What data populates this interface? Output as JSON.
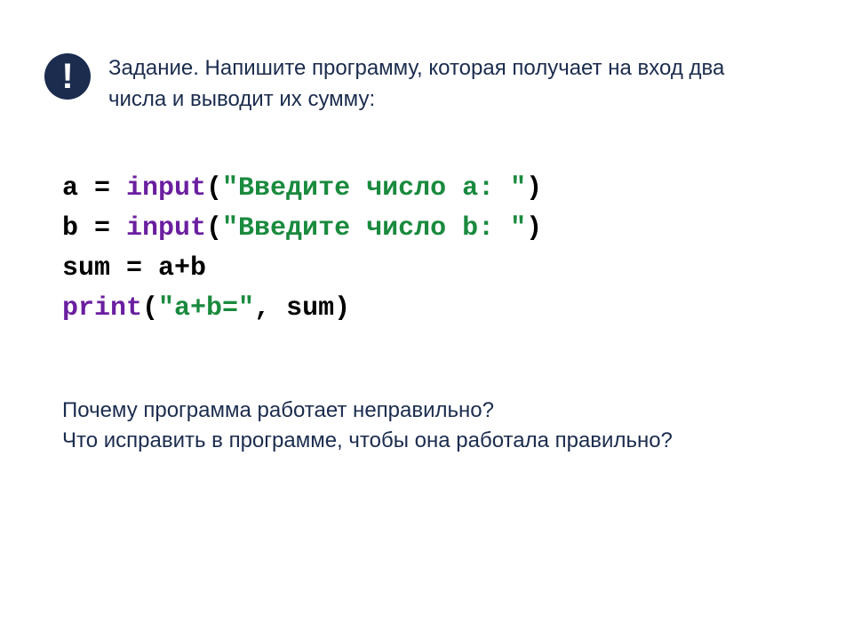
{
  "badge": "!",
  "task": "Задание. Напишите программу, которая получает на вход два числа и выводит их сумму:",
  "code": {
    "line1": {
      "a": "a = ",
      "fn": "input",
      "p1": "(",
      "s": "\"Введите число a: \"",
      "p2": ")"
    },
    "line2": {
      "a": "b = ",
      "fn": "input",
      "p1": "(",
      "s": "\"Введите число b: \"",
      "p2": ")"
    },
    "line3": {
      "a": "sum = a+b"
    },
    "line4": {
      "fn": "print",
      "p1": "(",
      "s": "\"a+b=\"",
      "c": ", sum",
      "p2": ")"
    }
  },
  "q1": "Почему программа работает неправильно?",
  "q2": "Что исправить в программе, чтобы она работала правильно?"
}
